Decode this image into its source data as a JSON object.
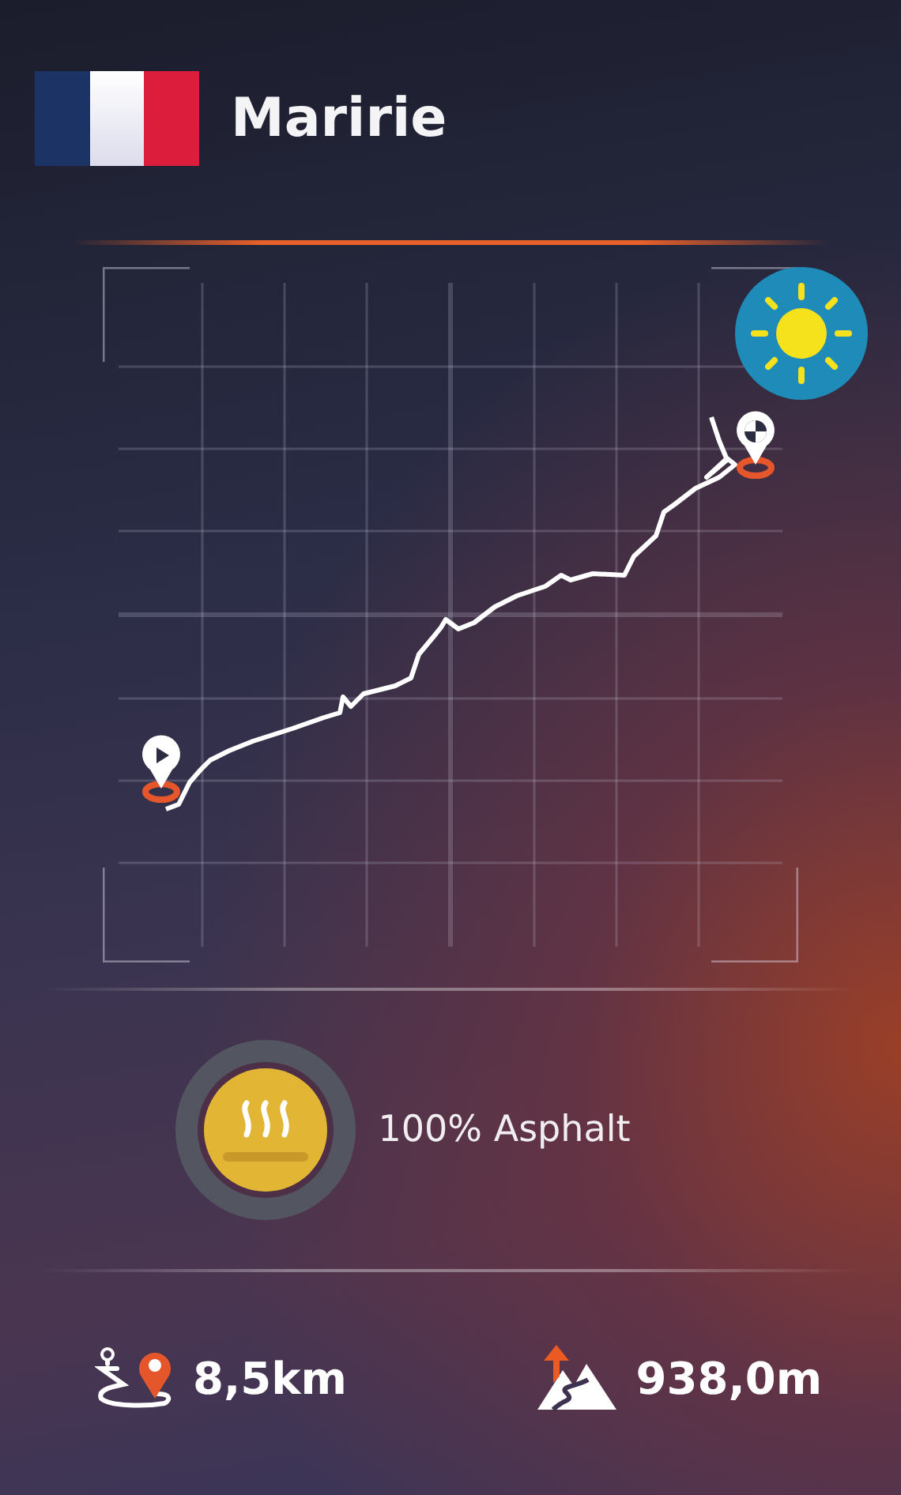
{
  "header": {
    "title": "Maririe"
  },
  "surface": {
    "label": "100% Asphalt"
  },
  "stats": [
    {
      "kind": "distance",
      "value": "8,5km"
    },
    {
      "kind": "elevation",
      "value": "938,0m"
    }
  ]
}
